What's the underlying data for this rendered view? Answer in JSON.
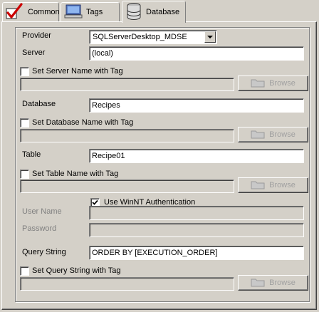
{
  "tabs": [
    {
      "label": "Common",
      "icon": "red-checkmark-icon"
    },
    {
      "label": "Tags",
      "icon": "monitor-icon"
    },
    {
      "label": "Database",
      "icon": "database-icon",
      "active": true
    }
  ],
  "form": {
    "provider_label": "Provider",
    "provider_value": "SQLServerDesktop_MDSE",
    "server_label": "Server",
    "server_value": "(local)",
    "server_tag_checkbox": "Set Server Name with Tag",
    "database_label": "Database",
    "database_value": "Recipes",
    "database_tag_checkbox": "Set Database Name with Tag",
    "table_label": "Table",
    "table_value": "Recipe01",
    "table_tag_checkbox": "Set Table Name with Tag",
    "winnt_checkbox": "Use WinNT Authentication",
    "winnt_checked": true,
    "username_label": "User Name",
    "password_label": "Password",
    "query_label": "Query String",
    "query_value": "ORDER BY [EXECUTION_ORDER]",
    "query_tag_checkbox": "Set Query String with Tag",
    "browse_label": "Browse"
  },
  "colors": {
    "face": "#d4d0c8",
    "checkmark": "#cc0000"
  }
}
